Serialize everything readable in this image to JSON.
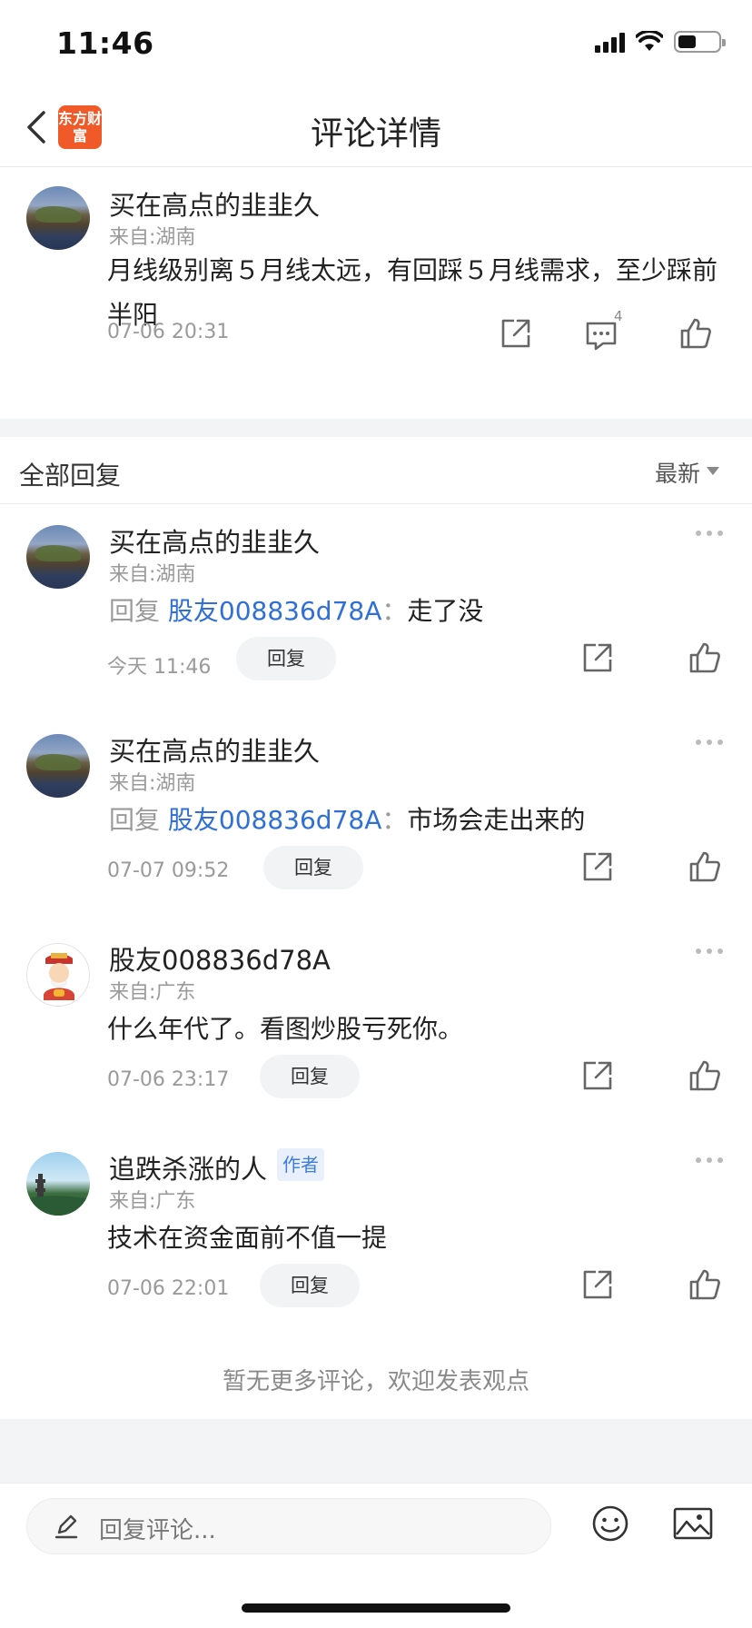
{
  "status_bar": {
    "time": "11:46"
  },
  "nav": {
    "title": "评论详情",
    "logo_text": "东方财富"
  },
  "main_comment": {
    "user": "买在高点的韭韭久",
    "location": "来自:湖南",
    "content": "月线级别离５月线太远，有回踩５月线需求，至少踩前半阳",
    "time": "07-06 20:31",
    "reply_count": "4"
  },
  "section": {
    "title": "全部回复",
    "sort": "最新"
  },
  "replies": [
    {
      "user": "买在高点的韭韭久",
      "location": "来自:湖南",
      "prefix": "回复",
      "target": "股友008836d78A",
      "colon": "：",
      "body": "走了没",
      "time": "今天 11:46",
      "reply_label": "回复"
    },
    {
      "user": "买在高点的韭韭久",
      "location": "来自:湖南",
      "prefix": "回复",
      "target": "股友008836d78A",
      "colon": "：",
      "body": "市场会走出来的",
      "time": "07-07 09:52",
      "reply_label": "回复"
    },
    {
      "user": "股友008836d78A",
      "location": "来自:广东",
      "body": "什么年代了。看图炒股亏死你。",
      "time": "07-06 23:17",
      "reply_label": "回复"
    },
    {
      "user": "追跌杀涨的人",
      "tag": "作者",
      "location": "来自:广东",
      "body": "技术在资金面前不值一提",
      "time": "07-06 22:01",
      "reply_label": "回复"
    }
  ],
  "footer_note": "暂无更多评论，欢迎发表观点",
  "input": {
    "placeholder": "回复评论..."
  },
  "colors": {
    "link_blue": "#2f6fd6",
    "brand_orange": "#ef5a28"
  }
}
